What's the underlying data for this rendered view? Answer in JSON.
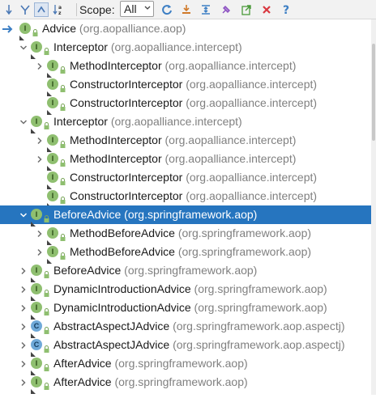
{
  "toolbar": {
    "scope_label": "Scope:",
    "scope_value": "All",
    "icons": [
      "sort-icon",
      "group-icon",
      "autoscroll-icon",
      "alphabetical-sort-icon",
      "refresh-icon",
      "export-icon",
      "expand-all-icon",
      "pin-icon",
      "navigate-icon",
      "close-icon",
      "help-icon"
    ]
  },
  "colors": {
    "selection": "#2675bf",
    "interface_icon": "#8fbf70",
    "class_icon": "#6fa9d8",
    "package_text": "#808080"
  },
  "tree": [
    {
      "name": "Advice",
      "pkg": "(org.aopalliance.aop)",
      "kind": "I",
      "chevron": "root"
    },
    {
      "name": "Interceptor",
      "pkg": "(org.aopalliance.intercept)",
      "kind": "I",
      "chevron": "down"
    },
    {
      "name": "MethodInterceptor",
      "pkg": "(org.aopalliance.intercept)",
      "kind": "I",
      "chevron": "right"
    },
    {
      "name": "ConstructorInterceptor",
      "pkg": "(org.aopalliance.intercept)",
      "kind": "I",
      "chevron": "none"
    },
    {
      "name": "ConstructorInterceptor",
      "pkg": "(org.aopalliance.intercept)",
      "kind": "I",
      "chevron": "none"
    },
    {
      "name": "Interceptor",
      "pkg": "(org.aopalliance.intercept)",
      "kind": "I",
      "chevron": "down"
    },
    {
      "name": "MethodInterceptor",
      "pkg": "(org.aopalliance.intercept)",
      "kind": "I",
      "chevron": "right"
    },
    {
      "name": "MethodInterceptor",
      "pkg": "(org.aopalliance.intercept)",
      "kind": "I",
      "chevron": "right"
    },
    {
      "name": "ConstructorInterceptor",
      "pkg": "(org.aopalliance.intercept)",
      "kind": "I",
      "chevron": "none"
    },
    {
      "name": "ConstructorInterceptor",
      "pkg": "(org.aopalliance.intercept)",
      "kind": "I",
      "chevron": "none"
    },
    {
      "name": "BeforeAdvice",
      "pkg": "(org.springframework.aop)",
      "kind": "I",
      "chevron": "down",
      "selected": true
    },
    {
      "name": "MethodBeforeAdvice",
      "pkg": "(org.springframework.aop)",
      "kind": "I",
      "chevron": "right"
    },
    {
      "name": "MethodBeforeAdvice",
      "pkg": "(org.springframework.aop)",
      "kind": "I",
      "chevron": "right"
    },
    {
      "name": "BeforeAdvice",
      "pkg": "(org.springframework.aop)",
      "kind": "I",
      "chevron": "right"
    },
    {
      "name": "DynamicIntroductionAdvice",
      "pkg": "(org.springframework.aop)",
      "kind": "I",
      "chevron": "right"
    },
    {
      "name": "DynamicIntroductionAdvice",
      "pkg": "(org.springframework.aop)",
      "kind": "I",
      "chevron": "right"
    },
    {
      "name": "AbstractAspectJAdvice",
      "pkg": "(org.springframework.aop.aspectj)",
      "kind": "C",
      "chevron": "right"
    },
    {
      "name": "AbstractAspectJAdvice",
      "pkg": "(org.springframework.aop.aspectj)",
      "kind": "C",
      "chevron": "right"
    },
    {
      "name": "AfterAdvice",
      "pkg": "(org.springframework.aop)",
      "kind": "I",
      "chevron": "right"
    },
    {
      "name": "AfterAdvice",
      "pkg": "(org.springframework.aop)",
      "kind": "I",
      "chevron": "right"
    }
  ]
}
